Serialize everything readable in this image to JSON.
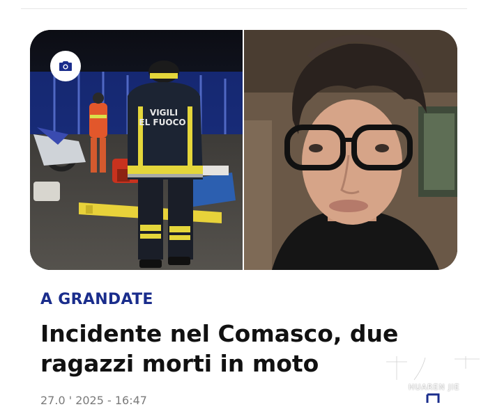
{
  "article": {
    "category": "A GRANDATE",
    "headline": "Incidente nel Comasco, due ragazzi morti in moto",
    "date_partial": "27.0 ' 2025 - 16:47",
    "hero_left_text": "VIGILI\nEL FUOCO",
    "colors": {
      "category": "#1a2d8c",
      "headline": "#111111"
    }
  },
  "icons": {
    "camera": "camera-icon",
    "bookmark": "bookmark-icon"
  },
  "watermark": {
    "logo_chars": "華人街",
    "text": "HUAREN JIE"
  }
}
